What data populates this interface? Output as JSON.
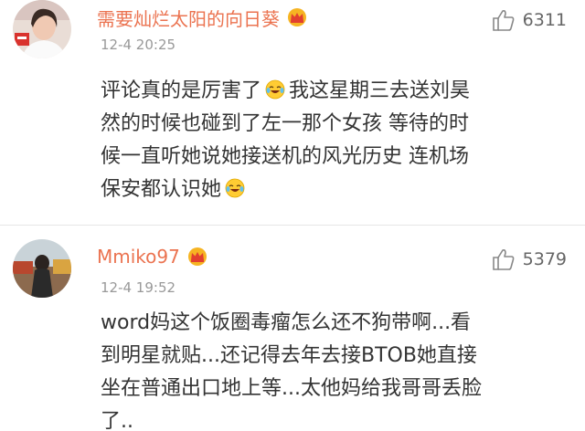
{
  "comments": [
    {
      "username": "需要灿烂太阳的向日葵",
      "timestamp": "12-4 20:25",
      "likes": "6311",
      "lines": [
        {
          "a": "评论真的是厉害了",
          "b": "我这星期三去送刘昊"
        },
        {
          "a": "然的时候也碰到了左一那个女孩 等待的时",
          "b": ""
        },
        {
          "a": "候一直听她说她接送机的风光历史 连机场",
          "b": ""
        },
        {
          "a": "保安都认识她",
          "b": ""
        }
      ]
    },
    {
      "username": "Mmiko97",
      "timestamp": "12-4 19:52",
      "likes": "5379",
      "lines": [
        "word妈这个饭圈毒瘤怎么还不狗带啊...看",
        "到明星就贴...还记得去年去接BTOB她直接",
        "坐在普通出口地上等...太他妈给我哥哥丢脸",
        "了.."
      ]
    }
  ],
  "icons": {
    "like": "thumbs-up-icon",
    "badge": "vip-crown-icon",
    "emoji": "laughing-crying-emoji"
  },
  "colors": {
    "username": "#eb7350",
    "badge": "#f6b422",
    "text": "#333333",
    "meta": "#999999"
  }
}
